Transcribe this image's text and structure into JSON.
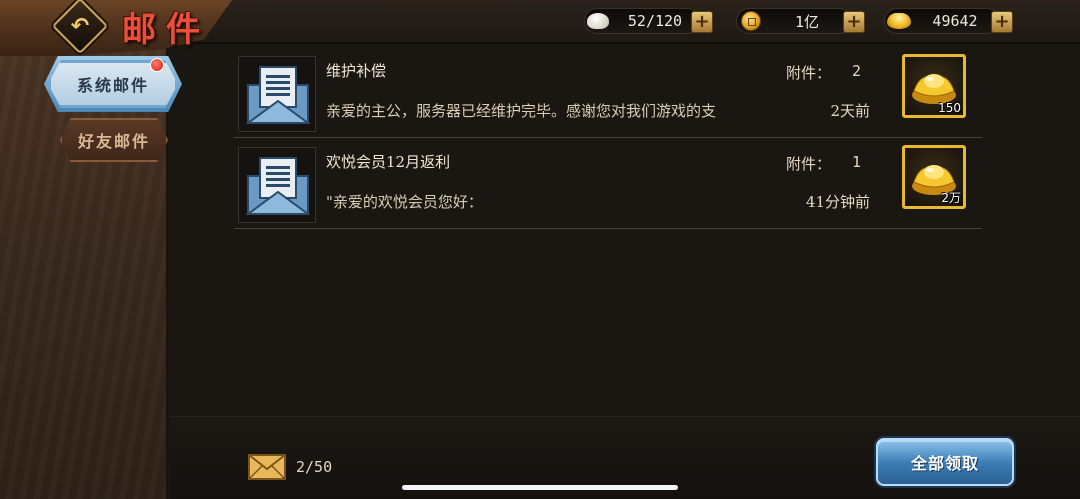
{
  "header": {
    "title": "邮件",
    "resources": [
      {
        "icon": "steamed-bun-icon",
        "value": "52/120"
      },
      {
        "icon": "copper-coin-icon",
        "value": "1亿"
      },
      {
        "icon": "gold-ingot-icon",
        "value": "49642"
      }
    ]
  },
  "tabs": [
    {
      "label": "系统邮件",
      "active": true,
      "has_notification": true
    },
    {
      "label": "好友邮件",
      "active": false
    }
  ],
  "mails": [
    {
      "title": "维护补偿",
      "preview": "亲爱的主公，服务器已经维护完毕。感谢您对我们游戏的支",
      "attachment_label": "附件：",
      "attachment_count": "2",
      "time": "2天前",
      "reward": {
        "icon": "gold-ingot-icon",
        "quantity": "150"
      }
    },
    {
      "title": "欢悦会员12月返利",
      "preview": "\"亲爱的欢悦会员您好：",
      "attachment_label": "附件：",
      "attachment_count": "1",
      "time": "41分钟前",
      "reward": {
        "icon": "gold-ingot-icon",
        "quantity": "2万"
      }
    }
  ],
  "footer": {
    "mail_count": "2/50",
    "claim_all_label": "全部领取"
  },
  "colors": {
    "title_red": "#e8503a",
    "reward_border": "#e8b830",
    "claim_button": "#3e7fb8",
    "active_tab": "#aecbe0"
  }
}
